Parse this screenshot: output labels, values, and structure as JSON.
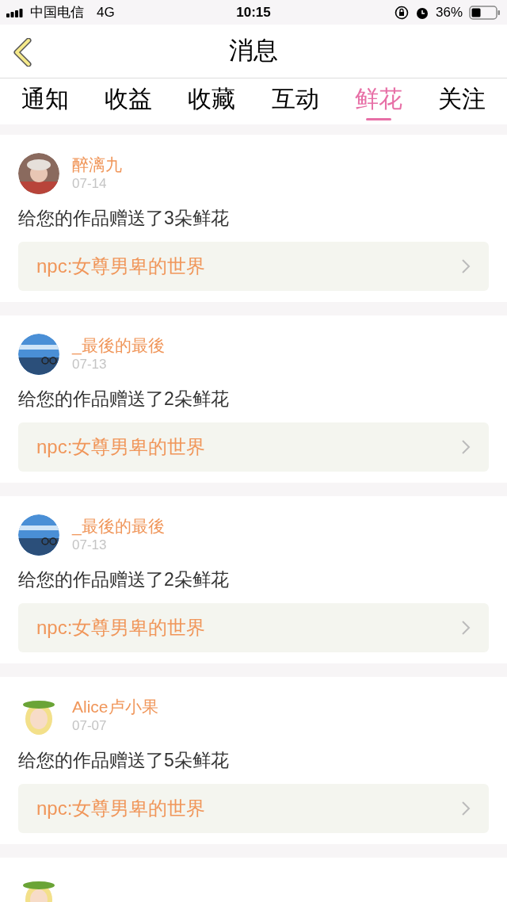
{
  "status_bar": {
    "carrier": "中国电信",
    "network": "4G",
    "time": "10:15",
    "battery_text": "36%"
  },
  "header": {
    "title": "消息"
  },
  "tabs": [
    {
      "label": "通知",
      "selected": false
    },
    {
      "label": "收益",
      "selected": false
    },
    {
      "label": "收藏",
      "selected": false
    },
    {
      "label": "互动",
      "selected": false
    },
    {
      "label": "鲜花",
      "selected": true
    },
    {
      "label": "关注",
      "selected": false
    }
  ],
  "messages": [
    {
      "user": "醉漓九",
      "avatar": {
        "kind": "portrait"
      },
      "date": "07-14",
      "text": "给您的作品赠送了3朵鲜花",
      "work": "npc:女尊男卑的世界"
    },
    {
      "user": "_最後的最後",
      "avatar": {
        "kind": "landscape"
      },
      "date": "07-13",
      "text": "给您的作品赠送了2朵鲜花",
      "work": "npc:女尊男卑的世界"
    },
    {
      "user": "_最後的最後",
      "avatar": {
        "kind": "landscape"
      },
      "date": "07-13",
      "text": "给您的作品赠送了2朵鲜花",
      "work": "npc:女尊男卑的世界"
    },
    {
      "user": "Alice卢小果",
      "avatar": {
        "kind": "cartoon"
      },
      "date": "07-07",
      "text": "给您的作品赠送了5朵鲜花",
      "work": "npc:女尊男卑的世界"
    },
    {
      "avatar": {
        "kind": "cartoon"
      }
    }
  ]
}
